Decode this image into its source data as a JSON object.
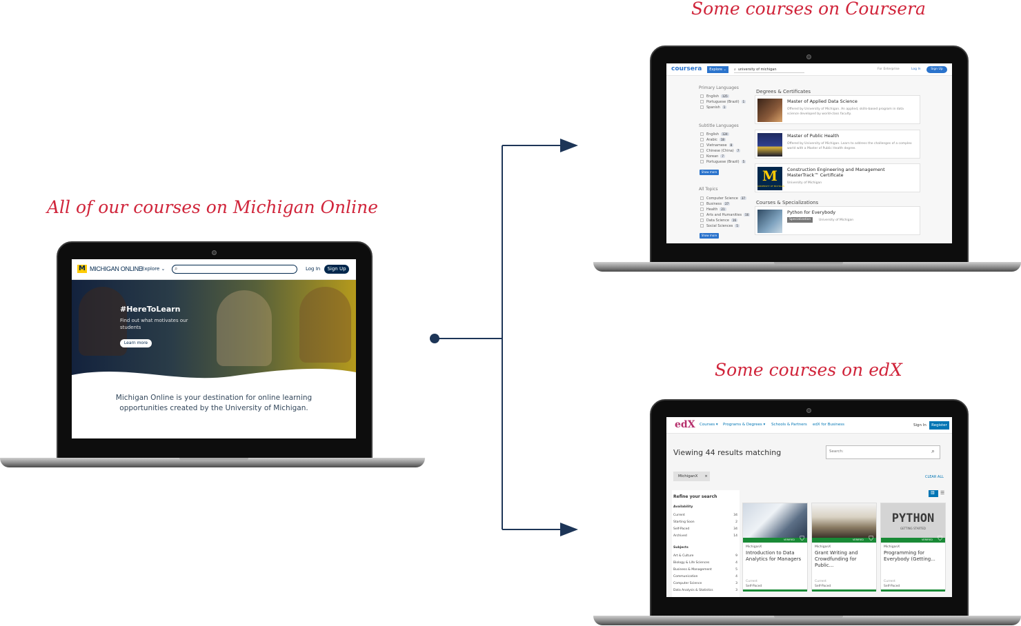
{
  "captions": {
    "michigan": "All of our courses on Michigan Online",
    "coursera": "Some courses on Coursera",
    "edx": "Some courses on edX"
  },
  "colors": {
    "caption": "#d0243a",
    "connector": "#1d3557",
    "michigan_navy": "#00274c",
    "coursera_blue": "#2a73cc",
    "edx_green": "#198a36"
  },
  "michigan_online": {
    "logo_letter": "M",
    "logo_text": "MICHIGAN ONLINE",
    "explore": "Explore",
    "login": "Log In",
    "signup": "Sign Up",
    "hero_title": "#HereToLearn",
    "hero_sub": "Find out what motivates our students",
    "learn_more": "Learn more",
    "tagline": "Michigan Online is your destination for online learning opportunities created by the University of Michigan."
  },
  "coursera": {
    "logo": "coursera",
    "explore": "Explore",
    "search": "university of michigan",
    "enterprise": "For Enterprise",
    "login": "Log In",
    "signup": "Sign Up",
    "primary_lang_label": "Primary Languages",
    "primary_langs": [
      {
        "name": "English",
        "count": "125"
      },
      {
        "name": "Portuguese (Brazil)",
        "count": "1"
      },
      {
        "name": "Spanish",
        "count": "1"
      }
    ],
    "subtitle_lang_label": "Subtitle Languages",
    "subtitle_langs": [
      {
        "name": "English",
        "count": "124"
      },
      {
        "name": "Arabic",
        "count": "18"
      },
      {
        "name": "Vietnamese",
        "count": "8"
      },
      {
        "name": "Chinese (China)",
        "count": "7"
      },
      {
        "name": "Korean",
        "count": "7"
      },
      {
        "name": "Portuguese (Brazil)",
        "count": "5"
      }
    ],
    "show_more": "Show more",
    "topics_label": "All Topics",
    "topics": [
      {
        "name": "Computer Science",
        "count": "37"
      },
      {
        "name": "Business",
        "count": "27"
      },
      {
        "name": "Health",
        "count": "21"
      },
      {
        "name": "Arts and Humanities",
        "count": "16"
      },
      {
        "name": "Data Science",
        "count": "16"
      },
      {
        "name": "Social Sciences",
        "count": "5"
      }
    ],
    "degrees_label": "Degrees & Certificates",
    "courses_label": "Courses & Specializations",
    "cards": [
      {
        "title": "Master of Applied Data Science",
        "desc": "Offered by University of Michigan. An applied, skills-based program in data science developed by world-class faculty."
      },
      {
        "title": "Master of Public Health",
        "desc": "Offered by University of Michigan. Learn to address the challenges of a complex world with a Master of Public Health degree."
      },
      {
        "title": "Construction Engineering and Management MasterTrack™ Certificate",
        "desc": "University of Michigan"
      },
      {
        "title": "Python for Everybody",
        "badge": "Specialization",
        "desc": "University of Michigan"
      }
    ],
    "umich_block": "M",
    "umich_small": "UNIVERSITY OF MICHIGAN"
  },
  "edx": {
    "logo": "edX",
    "nav": [
      "Courses",
      "Programs & Degrees",
      "Schools & Partners",
      "edX for Business"
    ],
    "signin": "Sign In",
    "register": "Register",
    "results": "Viewing 44 results matching",
    "search_placeholder": "Search:",
    "chip": "MichiganX",
    "chip_x": "×",
    "clear_all": "CLEAR ALL",
    "refine": "Refine your search",
    "availability_label": "Availability",
    "availability": [
      {
        "name": "Current",
        "count": "34"
      },
      {
        "name": "Starting Soon",
        "count": "2"
      },
      {
        "name": "Self-Paced",
        "count": "34"
      },
      {
        "name": "Archived",
        "count": "14"
      }
    ],
    "subjects_label": "Subjects",
    "subjects": [
      {
        "name": "Art & Culture",
        "count": "9"
      },
      {
        "name": "Biology & Life Sciences",
        "count": "4"
      },
      {
        "name": "Business & Management",
        "count": "5"
      },
      {
        "name": "Communication",
        "count": "4"
      },
      {
        "name": "Computer Science",
        "count": "3"
      },
      {
        "name": "Data Analysis & Statistics",
        "count": "3"
      }
    ],
    "verified": "VERIFIED",
    "cards": [
      {
        "org": "MichiganX",
        "title": "Introduction to Data Analytics for Managers",
        "status": "Current",
        "pace": "Self-Paced"
      },
      {
        "org": "MichiganX",
        "title": "Grant Writing and Crowdfunding for Public...",
        "status": "Current",
        "pace": "Self-Paced"
      },
      {
        "org": "MichiganX",
        "title": "Programming for Everybody (Getting...",
        "status": "Current",
        "pace": "Self-Paced",
        "image_text": "PYTHON",
        "image_sub": "GETTING STARTED"
      }
    ]
  }
}
